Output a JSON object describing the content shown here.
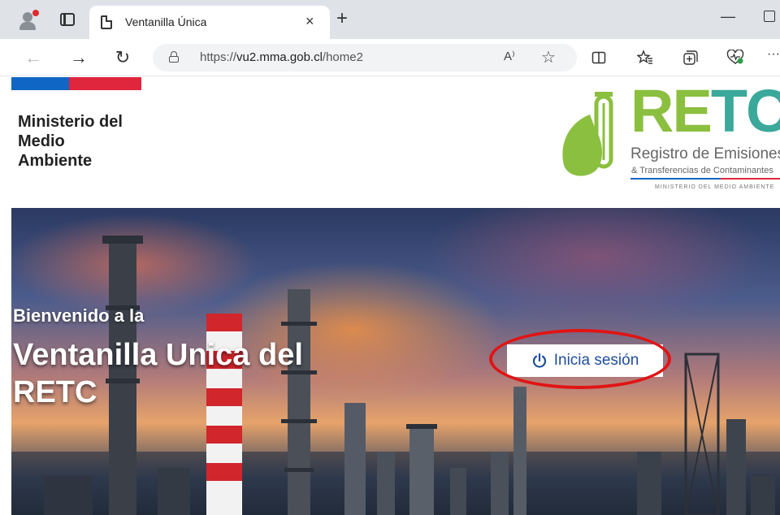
{
  "browser": {
    "tab_title": "Ventanilla Única",
    "tab_close": "×",
    "new_tab": "+",
    "minimize": "—",
    "url_prefix": "https://",
    "url_host": "vu2.mma.gob.cl",
    "url_path": "/home2",
    "read_aloud": "A⁾",
    "nav_back": "←",
    "nav_forward": "→",
    "nav_reload": "↻",
    "favorite": "☆",
    "toolbar_icons": [
      "split-screen-icon",
      "favorites-icon",
      "collections-icon",
      "extensions-icon",
      "more-icon"
    ],
    "more": "···"
  },
  "header": {
    "ministry_line1": "Ministerio del",
    "ministry_line2": "Medio",
    "ministry_line3": "Ambiente",
    "logo_word_a": "RE",
    "logo_word_b": "TC",
    "logo_sub1": "Registro de Emisiones",
    "logo_sub2": "& Transferencias de Contaminantes",
    "logo_sub3": "MINISTERIO DEL MEDIO AMBIENTE",
    "colors": {
      "flag_blue": "#0f66c4",
      "flag_red": "#e0263c",
      "logo_green": "#8bbf3f",
      "logo_teal": "#3aa89a"
    }
  },
  "hero": {
    "welcome": "Bienvenido a la",
    "title_line1": "Ventanilla Unica del",
    "title_line2": "RETC",
    "login_label": "Inicia sesión",
    "colors": {
      "login_text": "#1f4e9c",
      "highlight_ring": "#e11414"
    }
  }
}
